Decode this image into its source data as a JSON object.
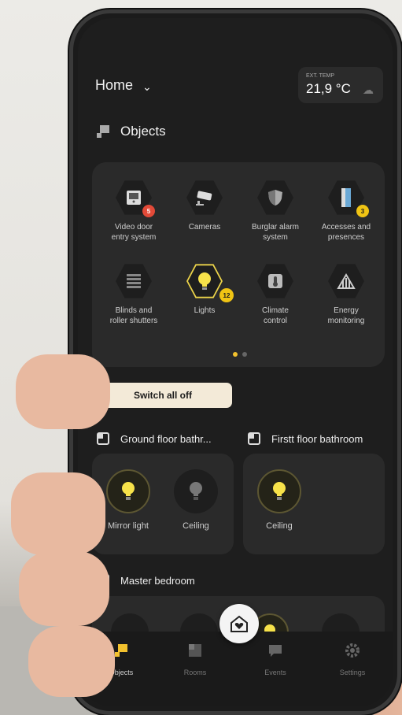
{
  "header": {
    "home_label": "Home",
    "temp_label": "EXT. TEMP",
    "temp_value": "21,9 °C"
  },
  "objects": {
    "title": "Objects",
    "tiles": [
      {
        "label": "Video door\nentry system",
        "badge": "5",
        "icon": "intercom-icon"
      },
      {
        "label": "Cameras",
        "icon": "camera-icon"
      },
      {
        "label": "Burglar alarm\nsystem",
        "icon": "shield-icon"
      },
      {
        "label": "Accesses and\npresences",
        "badge": "3",
        "icon": "door-icon"
      },
      {
        "label": "Blinds and\nroller shutters",
        "icon": "blinds-icon"
      },
      {
        "label": "Lights",
        "badge": "12",
        "icon": "bulb-icon"
      },
      {
        "label": "Climate\ncontrol",
        "icon": "thermometer-icon"
      },
      {
        "label": "Energy\nmonitoring",
        "icon": "energy-icon"
      }
    ]
  },
  "switch_all_off": "Switch all off",
  "rooms": [
    {
      "title": "Ground floor bathr...",
      "lights": [
        {
          "label": "Mirror light",
          "on": true
        },
        {
          "label": "Ceiling",
          "on": false
        }
      ]
    },
    {
      "title": "Firstt floor bathroom",
      "lights": [
        {
          "label": "Ceiling",
          "on": true
        }
      ]
    },
    {
      "title": "Master bedroom"
    }
  ],
  "nav": {
    "items": [
      "Objects",
      "Rooms",
      "Events",
      "Settings"
    ],
    "active": "Objects"
  },
  "colors": {
    "accent": "#f2c12e",
    "badge_red": "#e24a38",
    "screen_bg": "#1e1e1e",
    "card_bg": "#2a2a2a"
  }
}
